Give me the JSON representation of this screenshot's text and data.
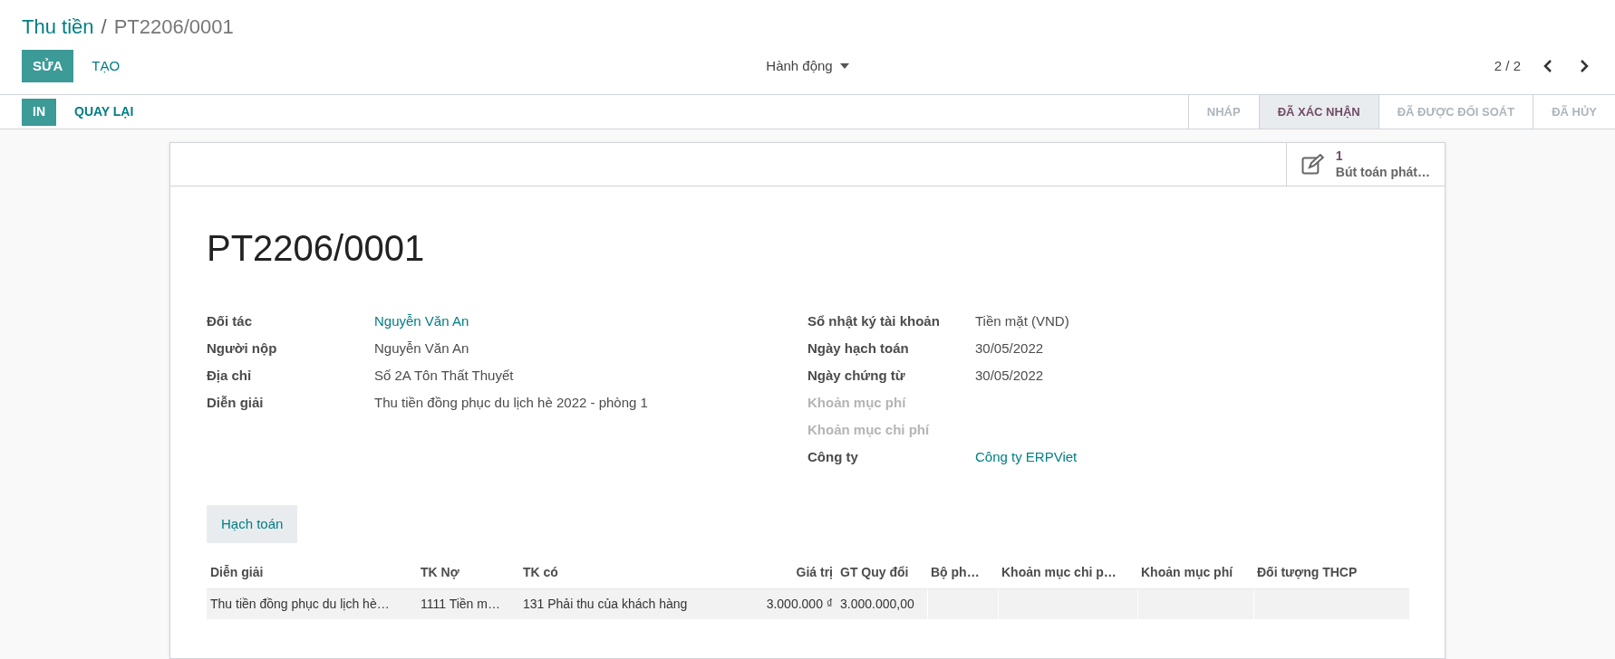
{
  "breadcrumb": {
    "parent": "Thu tiền",
    "separator": "/",
    "current": "PT2206/0001"
  },
  "toolbar": {
    "primary": "SỬA",
    "secondary": "TẠO",
    "action_menu": "Hành động",
    "pager": "2 / 2"
  },
  "statusbar": {
    "buttons": [
      {
        "label": "IN",
        "kind": "primary"
      },
      {
        "label": "QUAY LẠI",
        "kind": "link"
      }
    ],
    "steps": [
      {
        "label": "NHÁP",
        "selected": false
      },
      {
        "label": "ĐÃ XÁC NHẬN",
        "selected": true
      },
      {
        "label": "ĐÃ ĐƯỢC ĐỐI SOÁT",
        "selected": false
      },
      {
        "label": "ĐÃ HỦY",
        "selected": false
      }
    ]
  },
  "smart_button": {
    "count": "1",
    "label": "Bút toán phát…"
  },
  "title": "PT2206/0001",
  "left_fields": [
    {
      "label": "Đối tác",
      "value": "Nguyễn Văn An",
      "kind": "link",
      "disabled": false
    },
    {
      "label": "Người nộp",
      "value": "Nguyễn Văn An",
      "kind": "text",
      "disabled": false
    },
    {
      "label": "Địa chỉ",
      "value": "Số 2A Tôn Thất Thuyết",
      "kind": "text",
      "disabled": false
    },
    {
      "label": "Diễn giải",
      "value": "Thu tiền đồng phục du lịch hè 2022 - phòng 1",
      "kind": "text",
      "disabled": false
    }
  ],
  "right_fields": [
    {
      "label": "Sổ nhật ký tài khoản",
      "value": "Tiền mặt (VND)",
      "kind": "text",
      "disabled": false
    },
    {
      "label": "Ngày hạch toán",
      "value": "30/05/2022",
      "kind": "text",
      "disabled": false
    },
    {
      "label": "Ngày chứng từ",
      "value": "30/05/2022",
      "kind": "text",
      "disabled": false
    },
    {
      "label": "Khoản mục phí",
      "disabled": true
    },
    {
      "label": "Khoản mục chi phí",
      "disabled": true
    },
    {
      "label": "Công ty",
      "value": "Công ty ERPViet",
      "kind": "link",
      "disabled": false
    }
  ],
  "tabs": [
    {
      "label": "Hạch toán",
      "selected": true
    }
  ],
  "table": {
    "columns": [
      {
        "label": "Diễn giải",
        "kind": "text"
      },
      {
        "label": "TK Nợ",
        "kind": "text"
      },
      {
        "label": "TK có",
        "kind": "text"
      },
      {
        "label": "Giá trị",
        "kind": "amount"
      },
      {
        "label": "GT Quy đổi",
        "kind": "text"
      },
      {
        "label": "Bộ ph…",
        "kind": "text"
      },
      {
        "label": "Khoản mục chi p…",
        "kind": "text"
      },
      {
        "label": "Khoản mục phí",
        "kind": "text"
      },
      {
        "label": "Đối tượng THCP",
        "kind": "text"
      }
    ],
    "rows": [
      {
        "cells": [
          "Thu tiền đồng phục du lịch hè…",
          "1111 Tiền m…",
          "131 Phải thu của khách hàng",
          "3.000.000 ₫",
          "3.000.000,00",
          "",
          "",
          "",
          ""
        ]
      }
    ]
  }
}
